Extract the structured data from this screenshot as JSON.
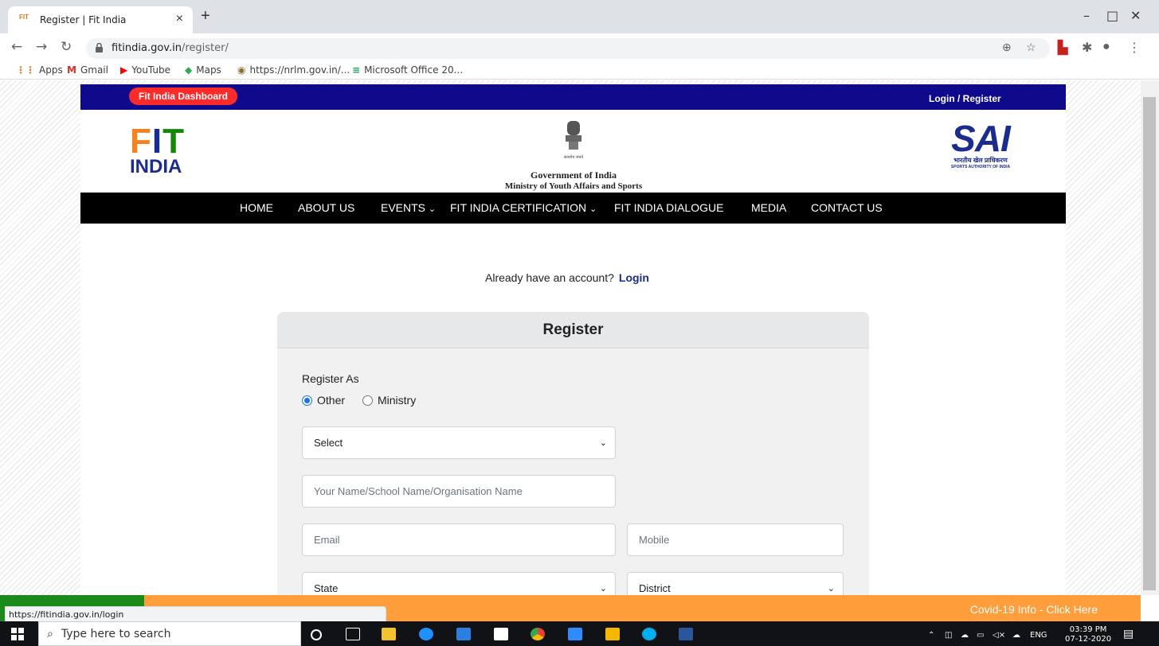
{
  "browser": {
    "tab_title": "Register | Fit India",
    "tab_favicon": "FIT",
    "url_host": "fitindia.gov.in",
    "url_path": "/register/",
    "bookmarks": [
      "Apps",
      "Gmail",
      "YouTube",
      "Maps",
      "https://nrlm.gov.in/...",
      "Microsoft Office 20..."
    ]
  },
  "site": {
    "dashboard_btn": "Fit India Dashboard",
    "login_register": "Login / Register",
    "fit_logo_top": "FIT",
    "fit_logo_bottom": "INDIA",
    "gov_small": "सत्यमेव जयते",
    "gov_line1": "Government of India",
    "gov_line2": "Ministry of Youth Affairs and Sports",
    "sai_big": "SAI",
    "sai_hindi": "भारतीय खेल प्राधिकरण",
    "sai_eng": "SPORTS AUTHORITY OF INDIA",
    "nav": [
      "HOME",
      "ABOUT US",
      "EVENTS",
      "FIT INDIA CERTIFICATION",
      "FIT INDIA DIALOGUE",
      "MEDIA",
      "CONTACT US"
    ]
  },
  "register": {
    "already_text": "Already have an account?",
    "login_link": "Login",
    "title": "Register",
    "register_as_label": "Register As",
    "option_other": "Other",
    "option_ministry": "Ministry",
    "selected_option": "Other",
    "select_value": "Select",
    "name_placeholder": "Your Name/School Name/Organisation Name",
    "email_placeholder": "Email",
    "mobile_placeholder": "Mobile",
    "state_value": "State",
    "district_value": "District"
  },
  "bottom": {
    "covid_link": "Covid-19 Info - Click Here",
    "status_url": "https://fitindia.gov.in/login"
  },
  "taskbar": {
    "search_placeholder": "Type here to search",
    "lang": "ENG",
    "time": "03:39 PM",
    "date": "07-12-2020"
  },
  "colors": {
    "topbar": "#0f0a8c",
    "dashboard_btn": "#ff2a2a",
    "covid_bar": "#ff9e3a",
    "link": "#1a2c8c"
  }
}
